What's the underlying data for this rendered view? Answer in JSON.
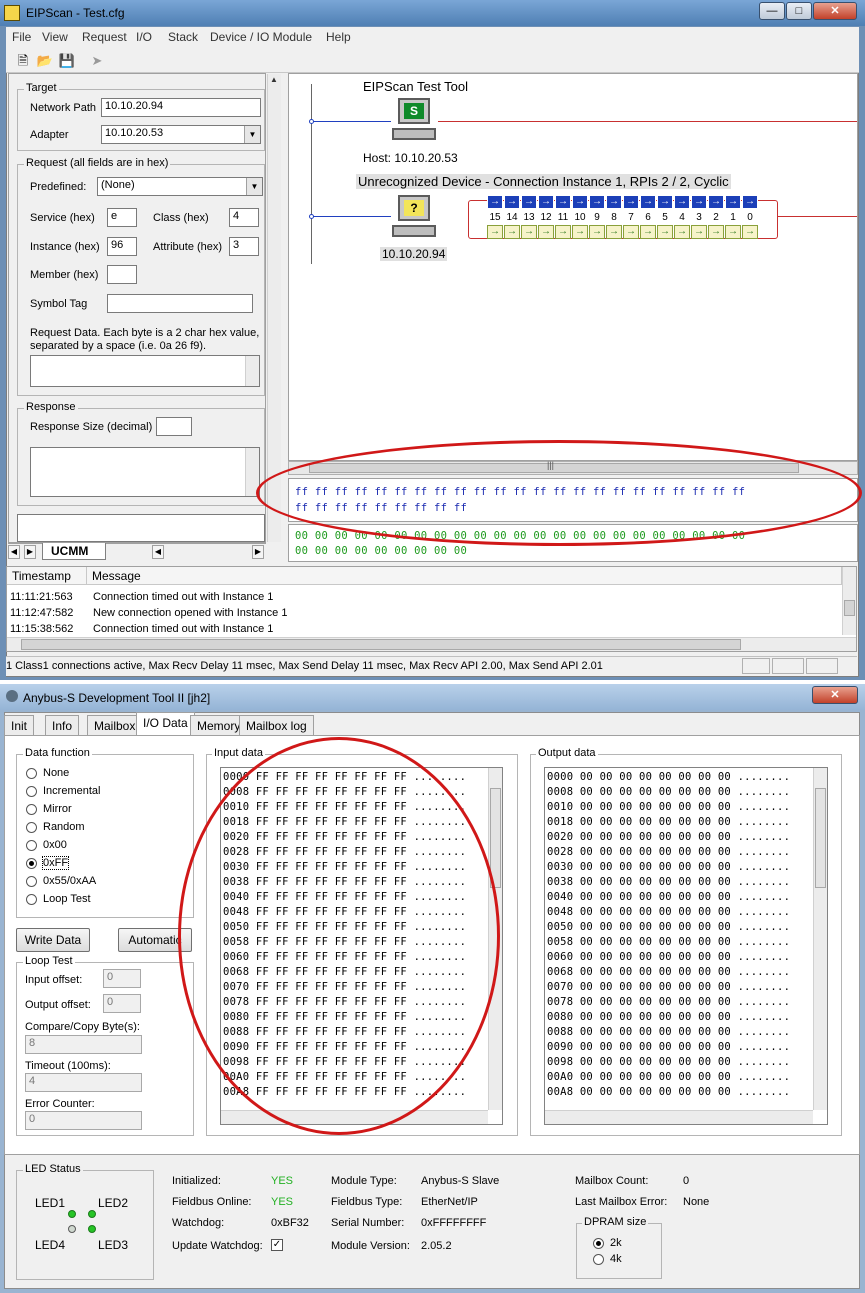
{
  "eip": {
    "title": "EIPScan - Test.cfg",
    "menu": [
      "File",
      "View",
      "Request",
      "I/O",
      "Stack",
      "Device / IO Module",
      "Help"
    ],
    "target": {
      "group_label": "Target",
      "network_path_label": "Network Path",
      "network_path": "10.10.20.94",
      "adapter_label": "Adapter",
      "adapter": "10.10.20.53"
    },
    "request": {
      "group_label": "Request (all fields are in hex)",
      "predefined_label": "Predefined:",
      "predefined": "(None)",
      "service_label": "Service (hex)",
      "service": "e",
      "class_label": "Class (hex)",
      "class": "4",
      "instance_label": "Instance (hex)",
      "instance": "96",
      "attribute_label": "Attribute (hex)",
      "attribute": "3",
      "member_label": "Member (hex)",
      "member": "",
      "symbol_label": "Symbol Tag",
      "symbol": "",
      "data_note": "Request Data. Each byte is a 2 char hex value, separated by a space (i.e. 0a 26 f9)."
    },
    "response": {
      "group_label": "Response",
      "size_label": "Response Size (decimal)",
      "size": ""
    },
    "tab_label": "UCMM",
    "diagram": {
      "tool_name": "EIPScan Test Tool",
      "host_label": "Host: 10.10.20.53",
      "device_label": "Unrecognized Device - Connection Instance 1, RPIs 2 / 2, Cyclic",
      "device_ip": "10.10.20.94",
      "io_numbers": [
        "15",
        "14",
        "13",
        "12",
        "11",
        "10",
        "9",
        "8",
        "7",
        "6",
        "5",
        "4",
        "3",
        "2",
        "1",
        "0"
      ]
    },
    "hex_out": [
      "ff ff ff ff ff ff ff ff ff ff ff ff ff ff ff ff ff ff ff ff ff ff ff",
      "ff ff ff ff ff ff ff ff ff"
    ],
    "hex_in": [
      "00 00 00 00 00 00 00 00 00 00 00 00 00 00 00 00 00 00 00 00 00 00 00",
      "00 00 00 00 00 00 00 00 00"
    ],
    "log": {
      "headers": [
        "Timestamp",
        "Message"
      ],
      "rows": [
        {
          "time": "11:11:21:563",
          "message": "Connection timed out with Instance 1"
        },
        {
          "time": "11:12:47:582",
          "message": "New connection opened with Instance 1"
        },
        {
          "time": "11:15:38:562",
          "message": "Connection timed out with Instance 1"
        }
      ]
    },
    "status": "1 Class1 connections active, Max Recv Delay 11 msec, Max Send Delay 11 msec, Max Recv API 2.00, Max Send API 2.01"
  },
  "anybus": {
    "title": "Anybus-S Development Tool II [jh2]",
    "tabs": [
      "Init",
      "Info",
      "Mailbox",
      "I/O Data",
      "Memory",
      "Mailbox log"
    ],
    "data_function": {
      "label": "Data function",
      "options": [
        "None",
        "Incremental",
        "Mirror",
        "Random",
        "0x00",
        "0xFF",
        "0x55/0xAA",
        "Loop Test"
      ],
      "selected": "0xFF"
    },
    "write_button": "Write Data",
    "auto_button": "Automatic",
    "loop_test": {
      "label": "Loop Test",
      "input_offset_label": "Input offset:",
      "input_offset": "0",
      "output_offset_label": "Output offset:",
      "output_offset": "0",
      "compare_label": "Compare/Copy Byte(s):",
      "compare": "8",
      "timeout_label": "Timeout (100ms):",
      "timeout": "4",
      "error_label": "Error Counter:",
      "error": "0"
    },
    "input_data": {
      "label": "Input data",
      "rows": [
        "0000 FF FF FF FF FF FF FF FF ........",
        "0008 FF FF FF FF FF FF FF FF ........",
        "0010 FF FF FF FF FF FF FF FF ........",
        "0018 FF FF FF FF FF FF FF FF ........",
        "0020 FF FF FF FF FF FF FF FF ........",
        "0028 FF FF FF FF FF FF FF FF ........",
        "0030 FF FF FF FF FF FF FF FF ........",
        "0038 FF FF FF FF FF FF FF FF ........",
        "0040 FF FF FF FF FF FF FF FF ........",
        "0048 FF FF FF FF FF FF FF FF ........",
        "0050 FF FF FF FF FF FF FF FF ........",
        "0058 FF FF FF FF FF FF FF FF ........",
        "0060 FF FF FF FF FF FF FF FF ........",
        "0068 FF FF FF FF FF FF FF FF ........",
        "0070 FF FF FF FF FF FF FF FF ........",
        "0078 FF FF FF FF FF FF FF FF ........",
        "0080 FF FF FF FF FF FF FF FF ........",
        "0088 FF FF FF FF FF FF FF FF ........",
        "0090 FF FF FF FF FF FF FF FF ........",
        "0098 FF FF FF FF FF FF FF FF ........",
        "00A0 FF FF FF FF FF FF FF FF ........",
        "00A8 FF FF FF FF FF FF FF FF ........"
      ]
    },
    "output_data": {
      "label": "Output data",
      "rows": [
        "0000 00 00 00 00 00 00 00 00 ........",
        "0008 00 00 00 00 00 00 00 00 ........",
        "0010 00 00 00 00 00 00 00 00 ........",
        "0018 00 00 00 00 00 00 00 00 ........",
        "0020 00 00 00 00 00 00 00 00 ........",
        "0028 00 00 00 00 00 00 00 00 ........",
        "0030 00 00 00 00 00 00 00 00 ........",
        "0038 00 00 00 00 00 00 00 00 ........",
        "0040 00 00 00 00 00 00 00 00 ........",
        "0048 00 00 00 00 00 00 00 00 ........",
        "0050 00 00 00 00 00 00 00 00 ........",
        "0058 00 00 00 00 00 00 00 00 ........",
        "0060 00 00 00 00 00 00 00 00 ........",
        "0068 00 00 00 00 00 00 00 00 ........",
        "0070 00 00 00 00 00 00 00 00 ........",
        "0078 00 00 00 00 00 00 00 00 ........",
        "0080 00 00 00 00 00 00 00 00 ........",
        "0088 00 00 00 00 00 00 00 00 ........",
        "0090 00 00 00 00 00 00 00 00 ........",
        "0098 00 00 00 00 00 00 00 00 ........",
        "00A0 00 00 00 00 00 00 00 00 ........",
        "00A8 00 00 00 00 00 00 00 00 ........"
      ]
    },
    "led_status": {
      "label": "LED Status",
      "led1": "LED1",
      "led2": "LED2",
      "led3": "LED3",
      "led4": "LED4"
    },
    "info": {
      "initialized_label": "Initialized:",
      "initialized": "YES",
      "fieldbus_online_label": "Fieldbus Online:",
      "fieldbus_online": "YES",
      "watchdog_label": "Watchdog:",
      "watchdog": "0xBF32",
      "update_watchdog_label": "Update Watchdog:",
      "module_type_label": "Module Type:",
      "module_type": "Anybus-S Slave",
      "fieldbus_type_label": "Fieldbus Type:",
      "fieldbus_type": "EtherNet/IP",
      "serial_label": "Serial Number:",
      "serial": "0xFFFFFFFF",
      "version_label": "Module Version:",
      "version": "2.05.2",
      "mailbox_count_label": "Mailbox Count:",
      "mailbox_count": "0",
      "last_error_label": "Last Mailbox Error:",
      "last_error": "None"
    },
    "dpram": {
      "label": "DPRAM size",
      "options": [
        "2k",
        "4k"
      ],
      "selected": "2k"
    }
  },
  "colors": {
    "annotation": "#d01818",
    "yes_text": "#22b022",
    "io_blue": "#1c3fb8",
    "hex_out_text": "#1a2ab0",
    "hex_in_text": "#1e9a1e"
  }
}
